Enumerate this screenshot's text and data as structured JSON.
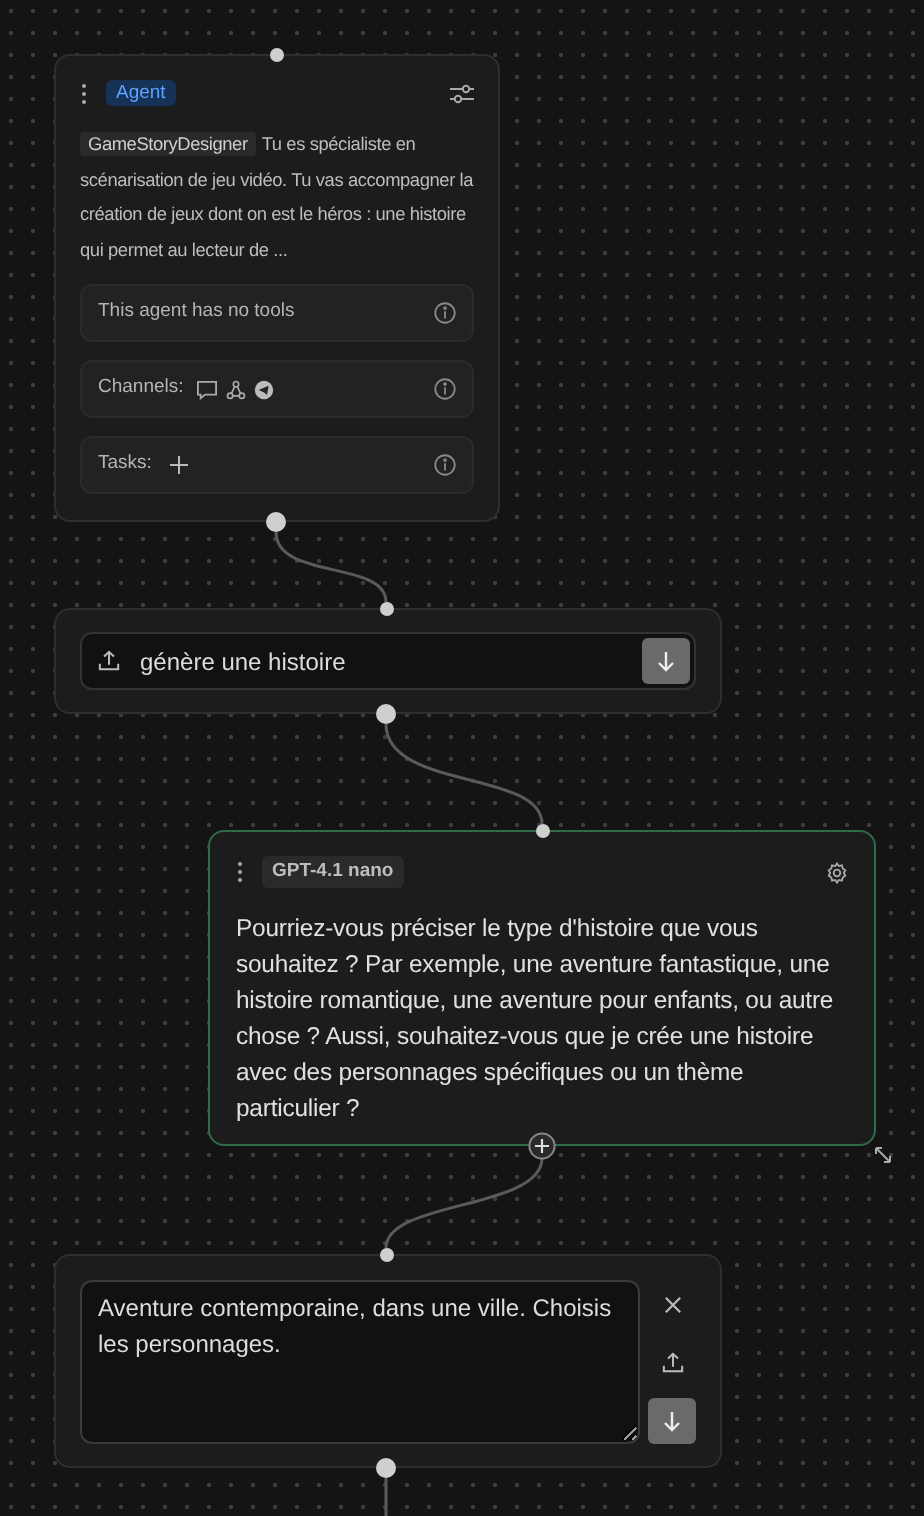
{
  "agent_node": {
    "badge": "Agent",
    "name_tag": "GameStoryDesigner",
    "description": "Tu es spécialiste en scénarisation de jeu vidéo. Tu vas accompagner la création de jeux dont on est le héros : une histoire qui permet au lecteur de ...",
    "rows": [
      {
        "kind": "tools",
        "label": "This agent has no tools"
      },
      {
        "kind": "channels",
        "label": "Channels:"
      },
      {
        "kind": "tasks",
        "label": "Tasks:"
      }
    ]
  },
  "input_node": {
    "value": "génère une histoire"
  },
  "response_node": {
    "model": "GPT-4.1 nano",
    "selected": true,
    "text": "Pourriez-vous préciser le type d'histoire que vous souhaitez ? Par exemple, une aventure fantastique, une histoire romantique, une aventure pour enfants, ou autre chose ? Aussi, souhaitez-vous que je crée une histoire avec des personnages spécifiques ou un thème particulier ?"
  },
  "prompt_node": {
    "value": "Aventure contemporaine, dans une ville. Choisis les personnages."
  }
}
